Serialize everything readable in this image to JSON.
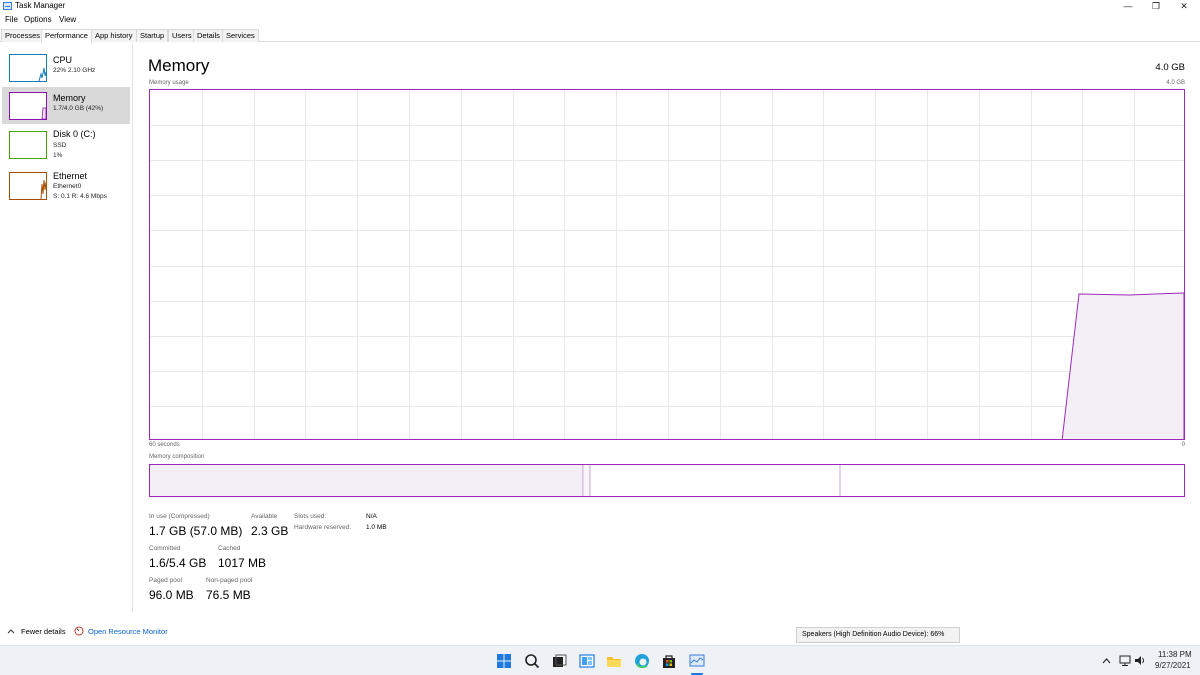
{
  "window": {
    "title": "Task Manager",
    "controls": {
      "minimize": "—",
      "restore": "❐",
      "close": "✕"
    }
  },
  "menu": [
    "File",
    "Options",
    "View"
  ],
  "tabs": [
    {
      "label": "Processes",
      "active": false
    },
    {
      "label": "Performance",
      "active": true
    },
    {
      "label": "App history",
      "active": false
    },
    {
      "label": "Startup",
      "active": false
    },
    {
      "label": "Users",
      "active": false
    },
    {
      "label": "Details",
      "active": false
    },
    {
      "label": "Services",
      "active": false
    }
  ],
  "sidebar": [
    {
      "title": "CPU",
      "sub1": "22% 2.10 GHz",
      "sub2": "",
      "sub3": "",
      "color": "#117dbb",
      "active": false
    },
    {
      "title": "Memory",
      "sub1": "1.7/4.0 GB (42%)",
      "sub2": "",
      "sub3": "",
      "color": "#8b12ae",
      "active": true
    },
    {
      "title": "Disk 0 (C:)",
      "sub1": "SSD",
      "sub2": "1%",
      "sub3": "",
      "color": "#4da60c",
      "active": false
    },
    {
      "title": "Ethernet",
      "sub1": "Ethernet0",
      "sub2": "S: 0.1  R: 4.6 Mbps",
      "sub3": "",
      "color": "#a74f01",
      "active": false
    }
  ],
  "main": {
    "title": "Memory",
    "capacity": "4.0 GB",
    "graph_label": "Memory usage",
    "graph_max": "4.0 GB",
    "time_left": "60 seconds",
    "time_right": "0",
    "composition_label": "Memory composition",
    "accent": "#9c2ab8",
    "usage_fraction_recent": 0.42
  },
  "stats": {
    "in_use_label": "In use (Compressed)",
    "in_use_value": "1.7 GB (57.0 MB)",
    "available_label": "Available",
    "available_value": "2.3 GB",
    "slots_label": "Slots used:",
    "slots_value": "N/A",
    "hw_reserved_label": "Hardware reserved:",
    "hw_reserved_value": "1.0 MB",
    "committed_label": "Committed",
    "committed_value": "1.6/5.4 GB",
    "cached_label": "Cached",
    "cached_value": "1017 MB",
    "paged_label": "Paged pool",
    "paged_value": "96.0 MB",
    "nonpaged_label": "Non-paged pool",
    "nonpaged_value": "76.5 MB"
  },
  "footer": {
    "fewer_details": "Fewer details",
    "open_monitor": "Open Resource Monitor",
    "tooltip": "Speakers (High Definition Audio Device): 66%"
  },
  "taskbar": {
    "icons": [
      "windows-start-icon",
      "search-icon",
      "task-view-icon",
      "widgets-icon",
      "file-explorer-icon",
      "edge-icon",
      "store-icon",
      "task-manager-icon"
    ],
    "time": "11:38 PM",
    "date": "9/27/2021"
  }
}
